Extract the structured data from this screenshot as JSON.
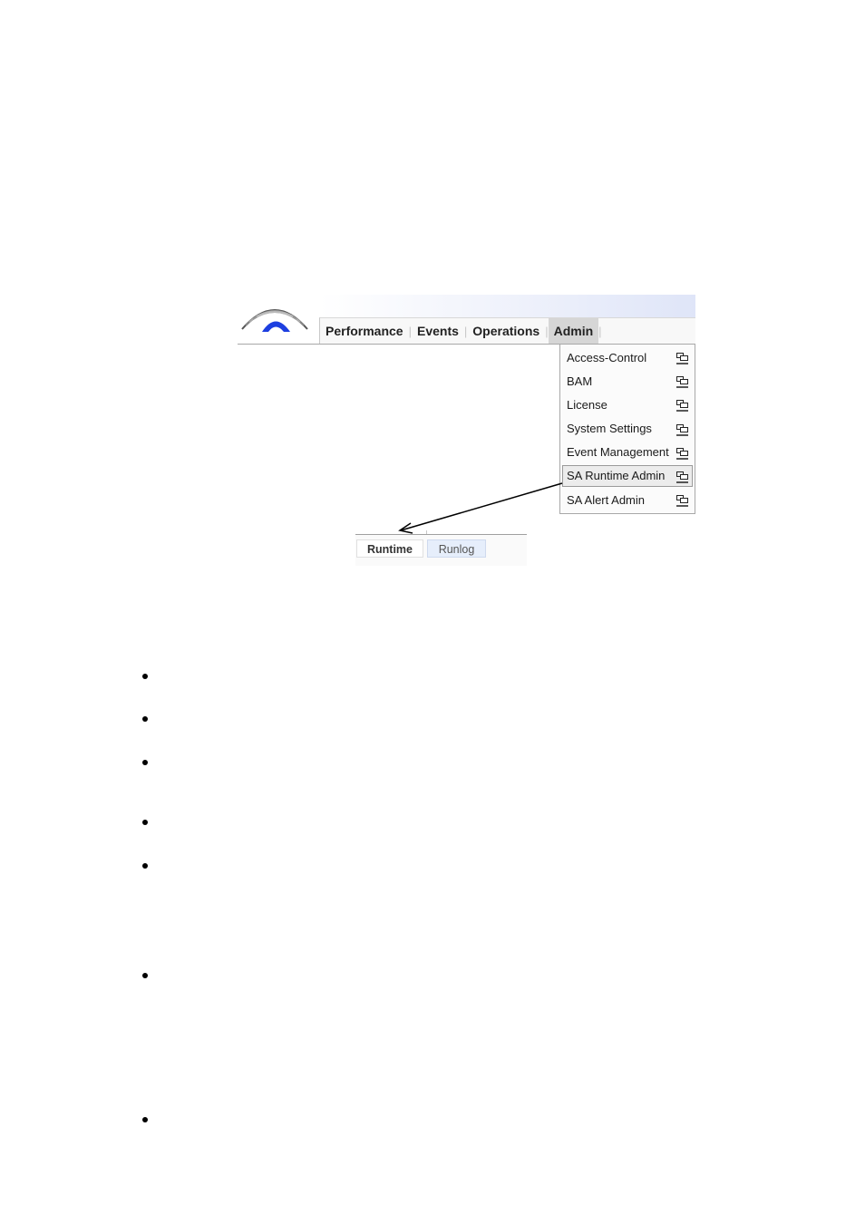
{
  "app": {
    "nav": {
      "items": [
        {
          "label": "Performance",
          "active": false
        },
        {
          "label": "Events",
          "active": false
        },
        {
          "label": "Operations",
          "active": false
        },
        {
          "label": "Admin",
          "active": true
        }
      ],
      "separator": "|"
    },
    "admin_menu": {
      "items": [
        {
          "label": "Access-Control",
          "icon": "open-window-icon",
          "highlighted": false
        },
        {
          "label": "BAM",
          "icon": "open-window-icon",
          "highlighted": false
        },
        {
          "label": "License",
          "icon": "open-window-icon",
          "highlighted": false
        },
        {
          "label": "System Settings",
          "icon": "open-window-icon",
          "highlighted": false
        },
        {
          "label": "Event Management",
          "icon": "open-window-icon",
          "highlighted": false
        },
        {
          "label": "SA Runtime Admin",
          "icon": "open-window-icon",
          "highlighted": true
        },
        {
          "label": "SA Alert Admin",
          "icon": "open-window-icon",
          "highlighted": false
        }
      ]
    },
    "tabs": [
      {
        "label": "Runtime",
        "active": true
      },
      {
        "label": "Runlog",
        "active": false
      }
    ],
    "colors": {
      "active_nav_bg": "#d6d6d6",
      "logo_blue": "#1d3fe0",
      "runlog_tab_bg": "#e6eefb"
    }
  },
  "document": {
    "bullet_count": 7
  }
}
